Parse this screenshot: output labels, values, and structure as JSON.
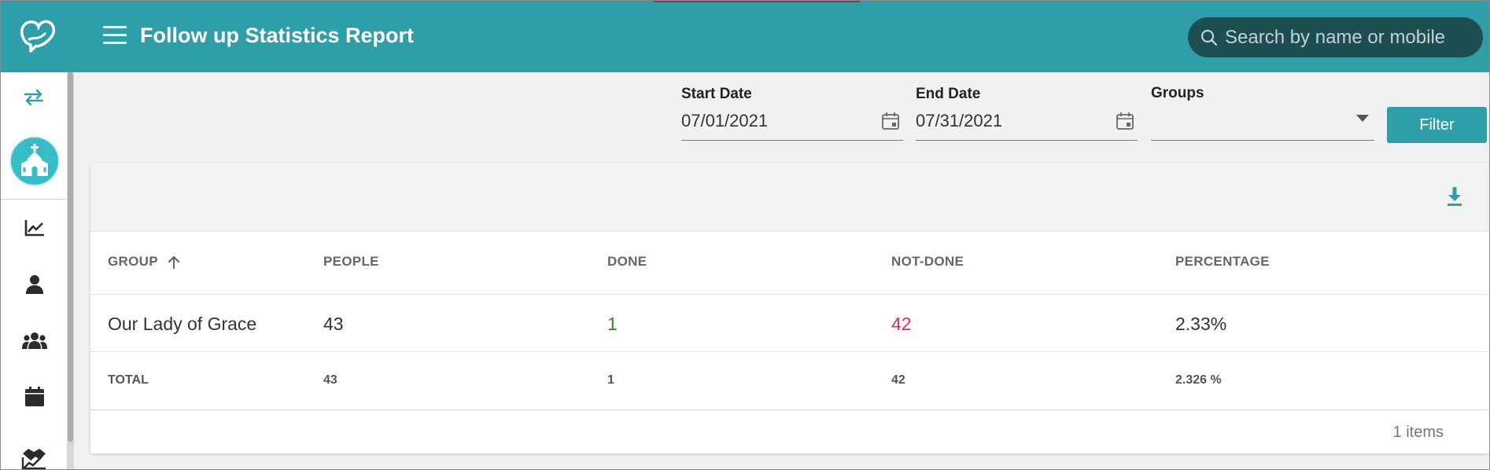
{
  "header": {
    "title": "Follow up Statistics Report",
    "search_placeholder": "Search by name or mobile"
  },
  "sidebar": {
    "items": [
      {
        "name": "swap-arrows-icon"
      },
      {
        "name": "church-icon"
      },
      {
        "name": "chart-line-icon"
      },
      {
        "name": "person-icon"
      },
      {
        "name": "users-group-icon"
      },
      {
        "name": "calendar-icon"
      },
      {
        "name": "handshake-chart-icon"
      }
    ]
  },
  "filters": {
    "start_date": {
      "label": "Start Date",
      "value": "07/01/2021"
    },
    "end_date": {
      "label": "End Date",
      "value": "07/31/2021"
    },
    "groups": {
      "label": "Groups",
      "value": ""
    },
    "filter_label": "Filter"
  },
  "table": {
    "headers": {
      "group": "GROUP",
      "people": "PEOPLE",
      "done": "DONE",
      "not_done": "NOT-DONE",
      "percentage": "PERCENTAGE"
    },
    "rows": [
      {
        "group": "Our Lady of Grace",
        "people": "43",
        "done": "1",
        "not_done": "42",
        "percentage": "2.33%"
      }
    ],
    "totals": {
      "label": "TOTAL",
      "people": "43",
      "done": "1",
      "not_done": "42",
      "percentage": "2.326 %"
    },
    "items_count": "1 items"
  },
  "colors": {
    "accent": "#2e9ea8",
    "done": "#2a8a2a",
    "not_done": "#e0304a"
  }
}
